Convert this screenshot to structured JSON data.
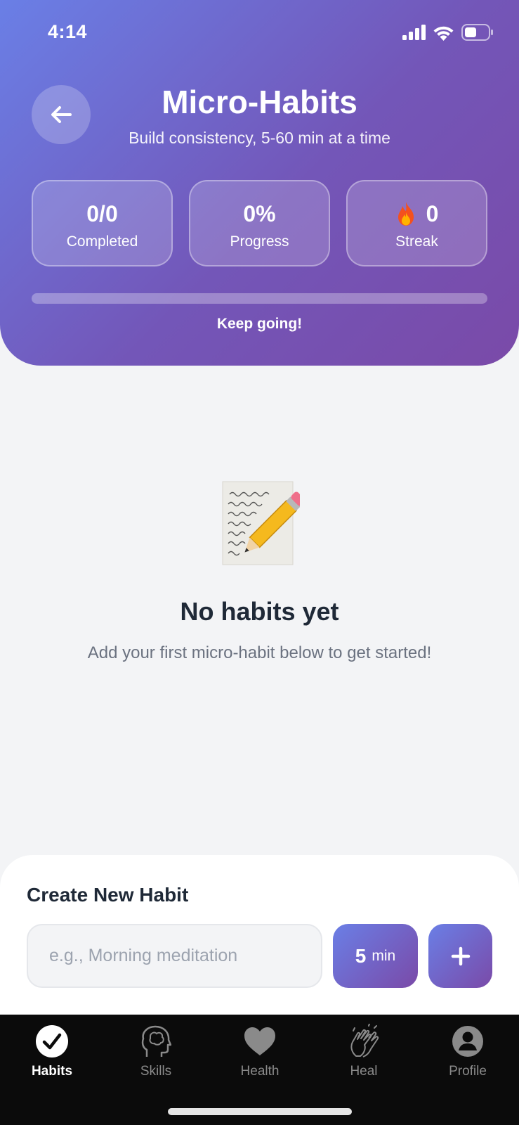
{
  "status_bar": {
    "time": "4:14"
  },
  "header": {
    "title": "Micro-Habits",
    "subtitle": "Build consistency, 5-60 min at a time",
    "stats": [
      {
        "value": "0/0",
        "label": "Completed"
      },
      {
        "value": "0%",
        "label": "Progress"
      },
      {
        "value": "0",
        "label": "Streak",
        "icon": "fire-icon"
      }
    ],
    "progress_fraction": 0,
    "progress_message": "Keep going!"
  },
  "empty_state": {
    "icon": "memo-icon",
    "title": "No habits yet",
    "message": "Add your first micro-habit below to get started!"
  },
  "create_habit": {
    "title": "Create New Habit",
    "input_placeholder": "e.g., Morning meditation",
    "input_value": "",
    "minutes_value": "5",
    "minutes_unit": "min",
    "add_label": "+"
  },
  "tabbar": {
    "items": [
      {
        "label": "Habits",
        "icon": "check-circle-icon",
        "active": true
      },
      {
        "label": "Skills",
        "icon": "brain-icon",
        "active": false
      },
      {
        "label": "Health",
        "icon": "heart-icon",
        "active": false
      },
      {
        "label": "Heal",
        "icon": "clapping-hands-icon",
        "active": false
      },
      {
        "label": "Profile",
        "icon": "person-circle-icon",
        "active": false
      }
    ]
  },
  "colors": {
    "header_gradient_start": "#6a7fe6",
    "header_gradient_end": "#7a4aa8",
    "background": "#f3f4f6",
    "tabbar": "#0b0b0b"
  }
}
